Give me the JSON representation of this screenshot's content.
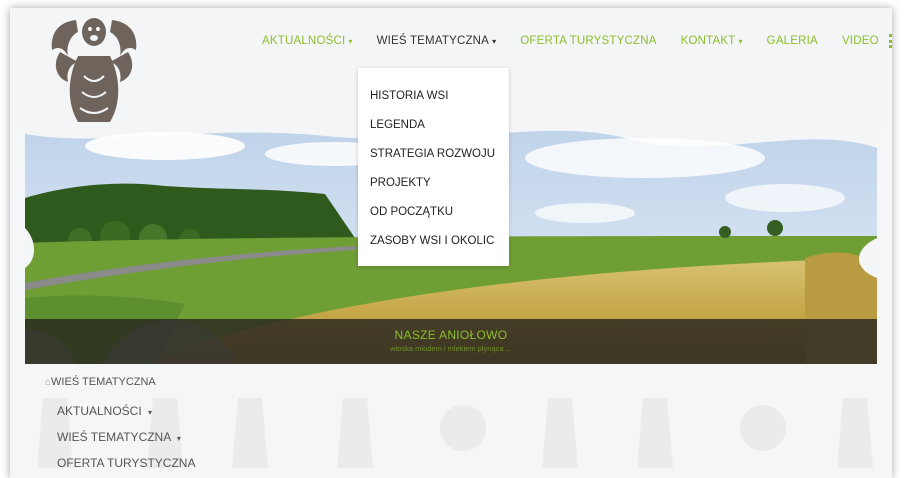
{
  "nav": {
    "items": [
      {
        "label": "AKTUALNOŚCI",
        "caret": "▾"
      },
      {
        "label": "WIEŚ TEMATYCZNA",
        "caret": "▾"
      },
      {
        "label": "OFERTA TURYSTYCZNA",
        "caret": ""
      },
      {
        "label": "KONTAKT",
        "caret": "▾"
      },
      {
        "label": "GALERIA",
        "caret": ""
      },
      {
        "label": "VIDEO",
        "caret": ""
      }
    ],
    "menu_icon": "hamburger-icon"
  },
  "dropdown": {
    "items": [
      {
        "label": "HISTORIA WSI"
      },
      {
        "label": "LEGENDA"
      },
      {
        "label": "STRATEGIA ROZWOJU"
      },
      {
        "label": "PROJEKTY"
      },
      {
        "label": "OD POCZĄTKU"
      },
      {
        "label": "ZASOBY WSI I OKOLIC"
      }
    ]
  },
  "banner": {
    "title": "NASZE ANIOŁOWO",
    "subtitle": "wioska miodem i mlekiem płynąca ..."
  },
  "breadcrumb": {
    "icon": "home-icon",
    "home_glyph": "⌂",
    "label": "WIEŚ TEMATYCZNA"
  },
  "submenu": {
    "items": [
      {
        "label": "AKTUALNOŚCI",
        "caret": "▾"
      },
      {
        "label": "WIEŚ TEMATYCZNA",
        "caret": "▾"
      },
      {
        "label": "OFERTA TURYSTYCZNA",
        "caret": ""
      }
    ]
  },
  "colors": {
    "accent": "#8cbf2a",
    "header_bg": "#f3f5f7",
    "banner_bg": "#28261e",
    "text": "#333333"
  }
}
